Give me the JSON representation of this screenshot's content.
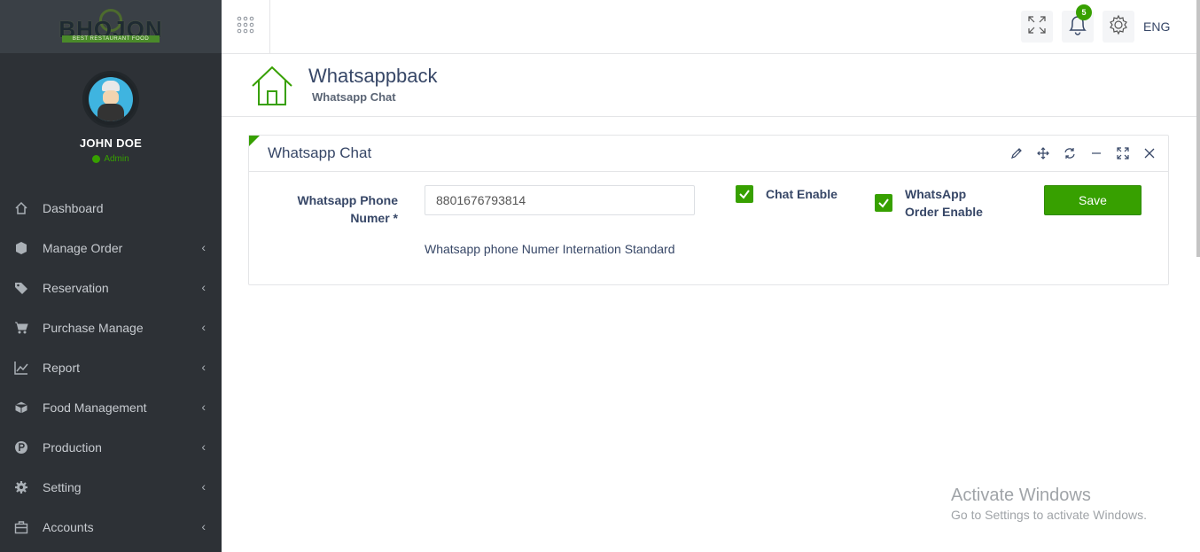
{
  "brand": {
    "logo_text": "BHOJON",
    "logo_sub": "BEST RESTAURANT FOOD"
  },
  "profile": {
    "name": "JOHN DOE",
    "role": "Admin"
  },
  "sidebar": {
    "items": [
      {
        "label": "Dashboard",
        "icon": "home-icon",
        "has_arrow": false
      },
      {
        "label": "Manage Order",
        "icon": "cube-icon",
        "has_arrow": true
      },
      {
        "label": "Reservation",
        "icon": "tag-icon",
        "has_arrow": true
      },
      {
        "label": "Purchase Manage",
        "icon": "cart-icon",
        "has_arrow": true
      },
      {
        "label": "Report",
        "icon": "chart-line-icon",
        "has_arrow": true
      },
      {
        "label": "Food Management",
        "icon": "box-icon",
        "has_arrow": true
      },
      {
        "label": "Production",
        "icon": "production-icon",
        "has_arrow": true
      },
      {
        "label": "Setting",
        "icon": "gear-icon",
        "has_arrow": true
      },
      {
        "label": "Accounts",
        "icon": "briefcase-icon",
        "has_arrow": true
      }
    ]
  },
  "topbar": {
    "notification_count": "5",
    "language": "ENG"
  },
  "header": {
    "title": "Whatsappback",
    "subtitle": "Whatsapp Chat"
  },
  "panel": {
    "title": "Whatsapp Chat",
    "phone_label": "Whatsapp Phone Numer *",
    "phone_value": "8801676793814",
    "help_text": "Whatsapp phone Numer Internation Standard",
    "chat_enable_label": "Chat Enable",
    "chat_enable_checked": true,
    "order_enable_label": "WhatsApp Order Enable",
    "order_enable_checked": true,
    "save_label": "Save"
  },
  "watermark": {
    "title": "Activate Windows",
    "subtitle": "Go to Settings to activate Windows."
  },
  "colors": {
    "accent": "#37a000",
    "sidebar": "#2d3136"
  }
}
